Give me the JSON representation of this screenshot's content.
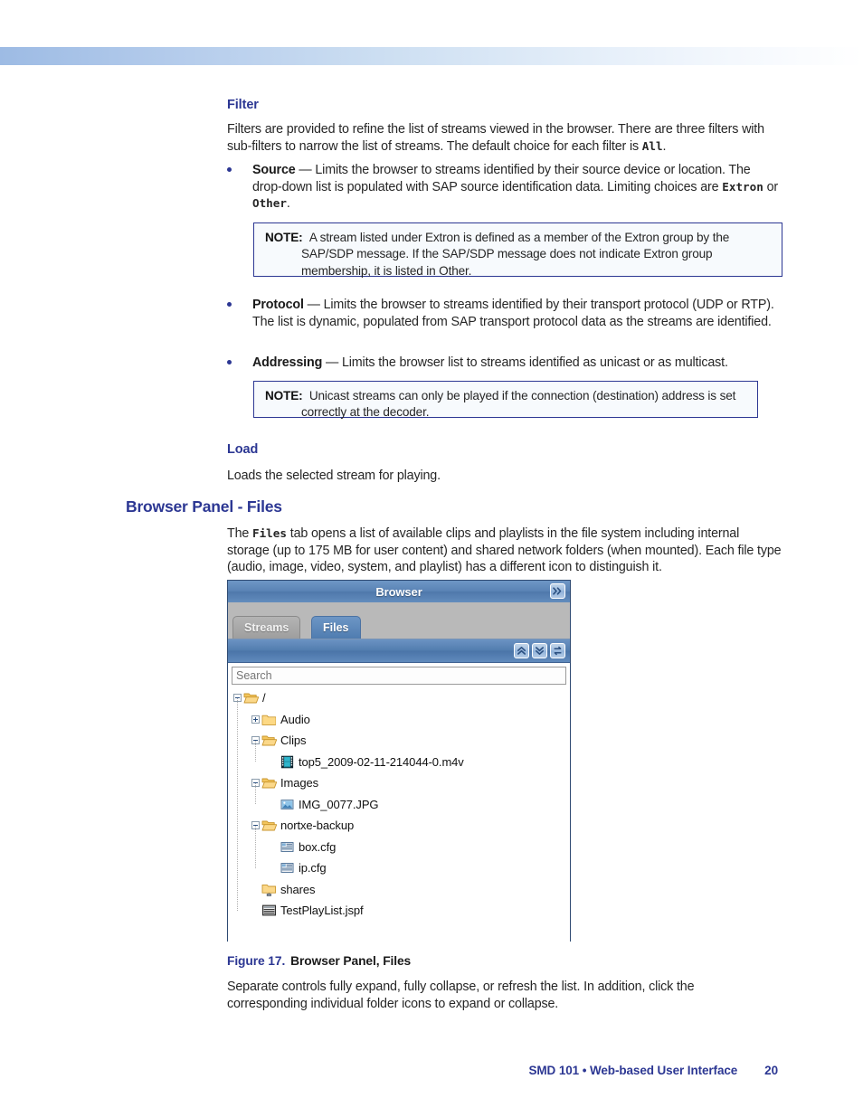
{
  "banner": {
    "present": true,
    "gradient_start": "#9dbbe4",
    "gradient_end": "#ffffff"
  },
  "sections": {
    "filter": {
      "heading": "Filter",
      "intro_a": "Filters are provided to refine the list of streams viewed in the browser. There are three filters with sub-filters to narrow the list of streams. The default choice for each filter is ",
      "intro_code": "All",
      "intro_b": ".",
      "bullets": [
        {
          "term": "Source",
          "dash": " — ",
          "text_a": "Limits the browser to streams identified by their source device or location. The drop-down list is populated with SAP source identification data. Limiting choices are ",
          "code_a": "Extron",
          "text_b": " or ",
          "code_b": "Other",
          "text_c": "."
        },
        {
          "term": "Protocol",
          "dash": " — ",
          "text_a": "Limits the browser to streams identified by their transport protocol (UDP or RTP). The list is dynamic, populated from SAP transport protocol data as the streams are identified.",
          "code_a": "",
          "text_b": "",
          "code_b": "",
          "text_c": ""
        },
        {
          "term": "Addressing",
          "dash": " — ",
          "text_a": "Limits the browser list to streams identified as unicast or as multicast.",
          "code_a": "",
          "text_b": "",
          "code_b": "",
          "text_c": ""
        }
      ],
      "notes": [
        {
          "label": "NOTE:",
          "text": "A stream listed under Extron is defined as a member of the Extron group by the SAP/SDP message. If the SAP/SDP message does not indicate Extron group membership, it is listed in Other."
        },
        {
          "label": "NOTE:",
          "text": "Unicast streams can only be played if the connection (destination) address is set correctly at the decoder."
        }
      ]
    },
    "load": {
      "heading": "Load",
      "text": "Loads the selected stream for playing."
    },
    "browser_panel_files": {
      "heading": "Browser Panel - Files",
      "intro_a": "The ",
      "intro_code": "Files",
      "intro_b": " tab opens a list of available clips and playlists in the file system including internal storage (up to 175 MB for user content) and shared network folders (when mounted). Each file type (audio, image, video, system, and playlist) has a different icon to distinguish it.",
      "after_figure": "Separate controls fully expand, fully collapse, or refresh the list. In addition, click the corresponding individual folder icons to expand or collapse."
    }
  },
  "figure": {
    "number": "Figure 17.",
    "title": "Browser Panel, Files"
  },
  "browser_ui": {
    "title": "Browser",
    "collapse_icon": "double-chevron-right-icon",
    "tabs": [
      {
        "label": "Streams",
        "active": false
      },
      {
        "label": "Files",
        "active": true
      }
    ],
    "toolbar_buttons": [
      {
        "name": "expand-all-button",
        "icon": "double-chevron-up-icon"
      },
      {
        "name": "collapse-all-button",
        "icon": "double-chevron-down-icon"
      },
      {
        "name": "refresh-button",
        "icon": "refresh-icon"
      }
    ],
    "search": {
      "placeholder": "Search",
      "value": ""
    },
    "tree": [
      {
        "label": "/",
        "depth": 0,
        "toggle": "minus",
        "icon": "folder-open-icon"
      },
      {
        "label": "Audio",
        "depth": 1,
        "toggle": "plus",
        "icon": "folder-closed-icon"
      },
      {
        "label": "Clips",
        "depth": 1,
        "toggle": "minus",
        "icon": "folder-open-icon"
      },
      {
        "label": "top5_2009-02-11-214044-0.m4v",
        "depth": 2,
        "toggle": "none",
        "icon": "video-file-icon"
      },
      {
        "label": "Images",
        "depth": 1,
        "toggle": "minus",
        "icon": "folder-open-icon"
      },
      {
        "label": "IMG_0077.JPG",
        "depth": 2,
        "toggle": "none",
        "icon": "image-file-icon"
      },
      {
        "label": "nortxe-backup",
        "depth": 1,
        "toggle": "minus",
        "icon": "folder-open-icon"
      },
      {
        "label": "box.cfg",
        "depth": 2,
        "toggle": "none",
        "icon": "config-file-icon"
      },
      {
        "label": "ip.cfg",
        "depth": 2,
        "toggle": "none",
        "icon": "config-file-icon"
      },
      {
        "label": "shares",
        "depth": 1,
        "toggle": "none",
        "icon": "network-folder-icon"
      },
      {
        "label": "TestPlayList.jspf",
        "depth": 1,
        "toggle": "none",
        "icon": "playlist-file-icon"
      }
    ]
  },
  "footer": {
    "text": "SMD 101 • Web-based User Interface",
    "page": "20"
  },
  "colors": {
    "heading_blue": "#2c3793",
    "note_border": "#2c3793",
    "note_bg": "#f7fafd",
    "panel_blue": "#5a83b5",
    "folder_yellow": "#f5c34a"
  }
}
